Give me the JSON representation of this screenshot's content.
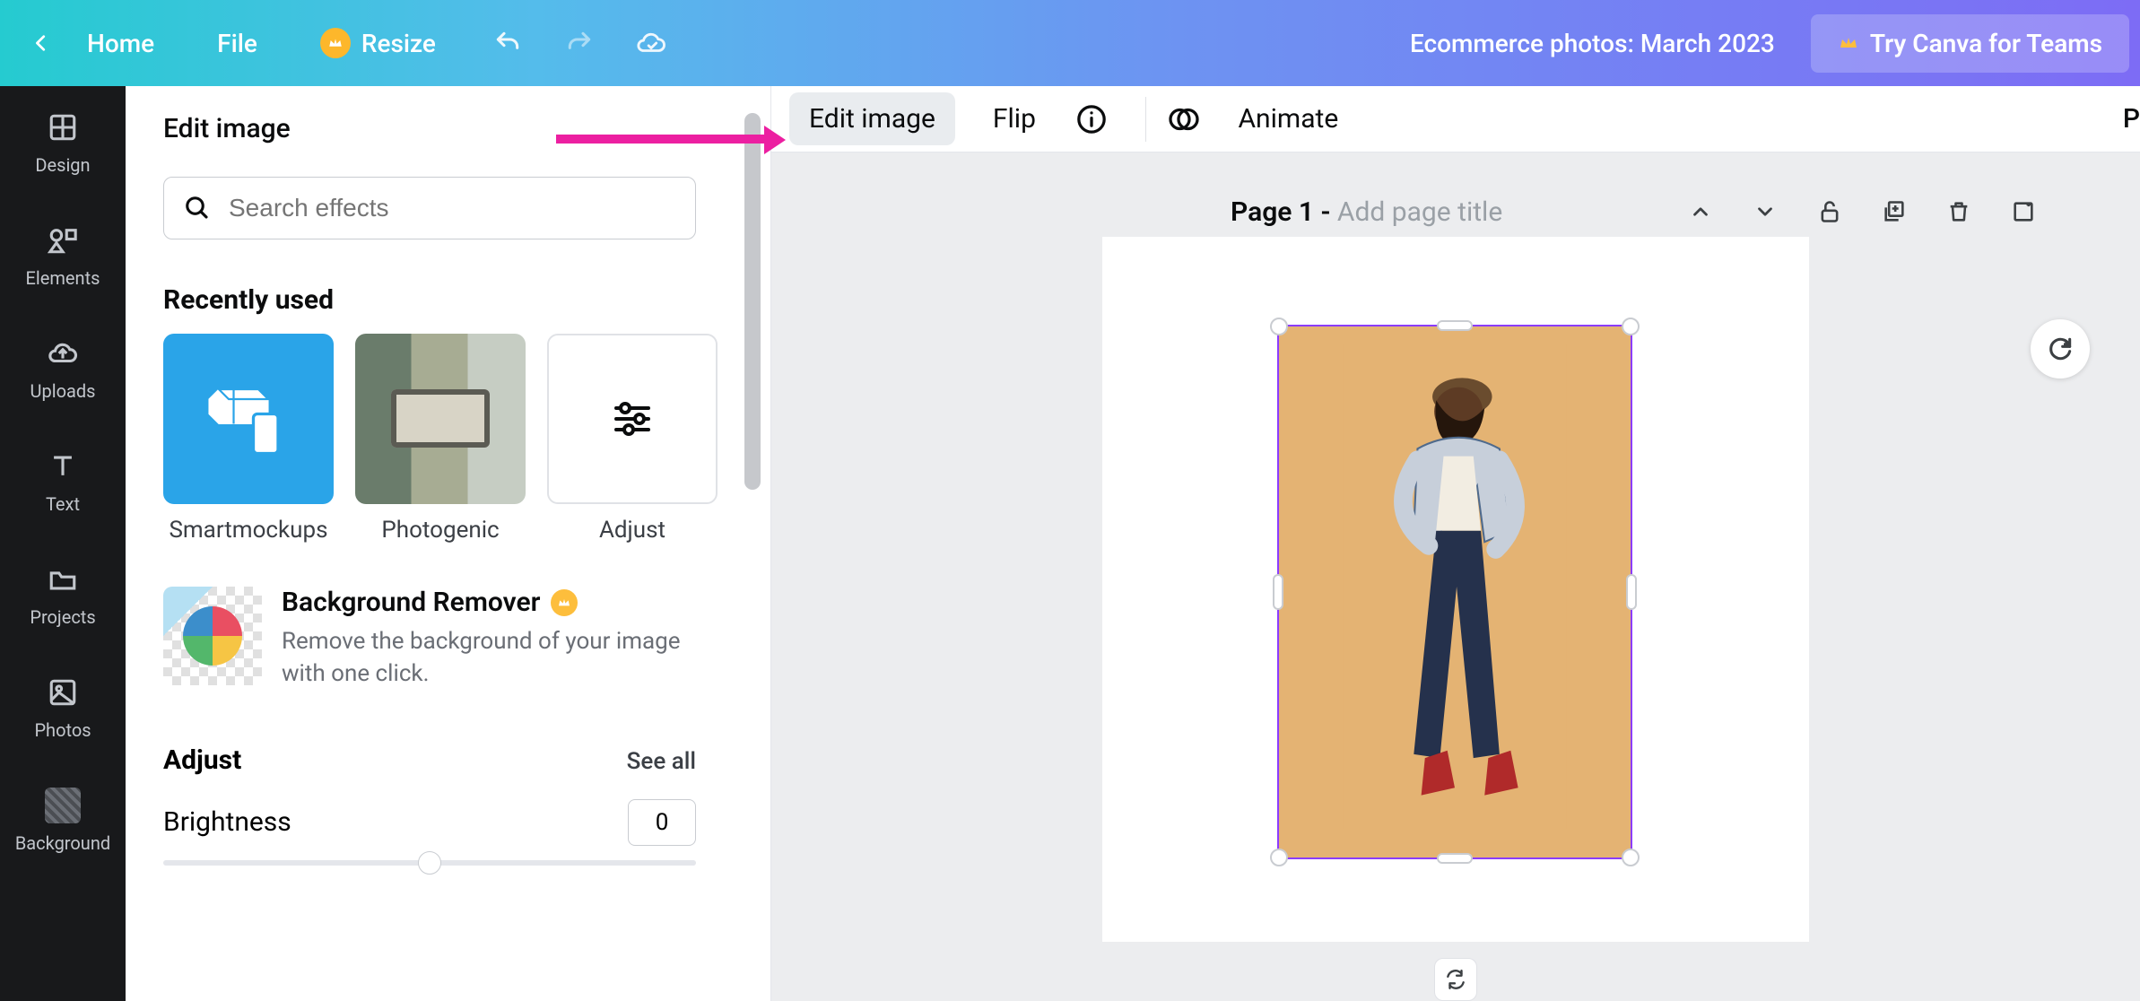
{
  "topbar": {
    "home": "Home",
    "file": "File",
    "resize": "Resize",
    "doc_title": "Ecommerce photos: March 2023",
    "try_teams": "Try Canva for Teams"
  },
  "leftnav": {
    "design": "Design",
    "elements": "Elements",
    "uploads": "Uploads",
    "text": "Text",
    "projects": "Projects",
    "photos": "Photos",
    "background": "Background"
  },
  "panel": {
    "title": "Edit image",
    "search_placeholder": "Search effects",
    "recently_used": "Recently used",
    "thumbs": {
      "smartmockups": "Smartmockups",
      "photogenic": "Photogenic",
      "adjust": "Adjust"
    },
    "bg_remover": {
      "title": "Background Remover",
      "desc": "Remove the background of your image with one click."
    },
    "adjust_section": {
      "label": "Adjust",
      "see_all": "See all",
      "brightness_label": "Brightness",
      "brightness_value": "0"
    }
  },
  "context_bar": {
    "edit_image": "Edit image",
    "flip": "Flip",
    "animate": "Animate",
    "right_p": "P"
  },
  "page_strip": {
    "page_label": "Page 1 - ",
    "add_title_placeholder": "Add page title"
  }
}
